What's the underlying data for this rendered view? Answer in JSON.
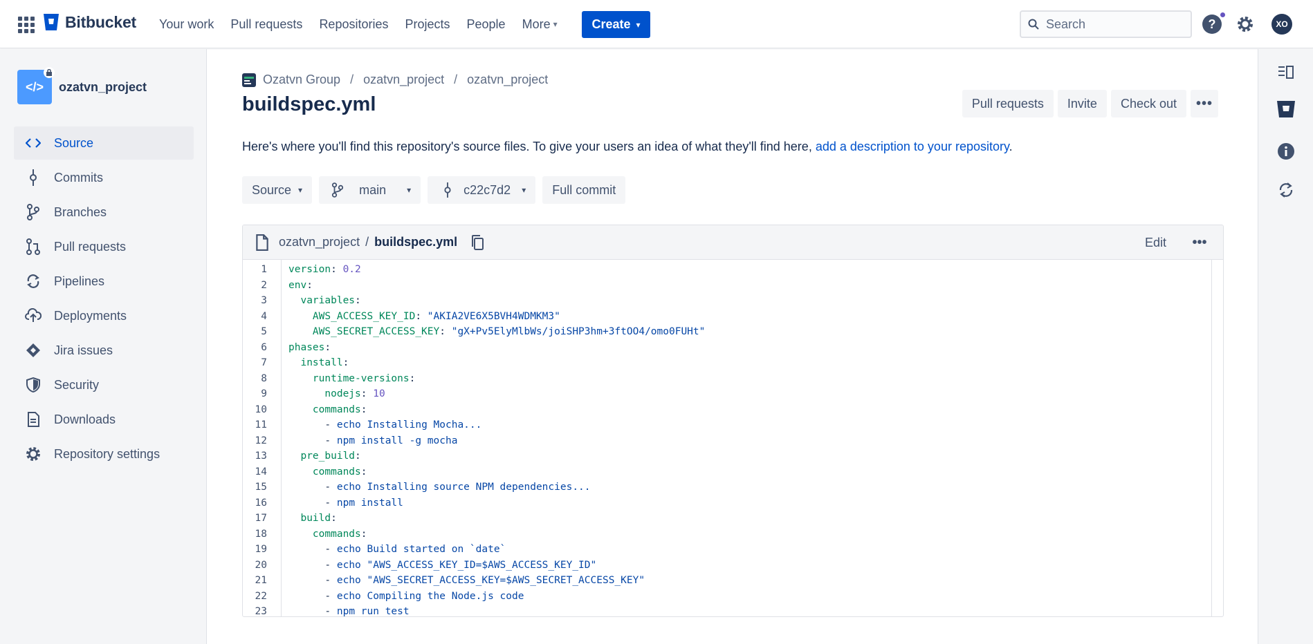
{
  "nav": {
    "product": "Bitbucket",
    "items": [
      "Your work",
      "Pull requests",
      "Repositories",
      "Projects",
      "People",
      "More"
    ],
    "create_label": "Create",
    "search_placeholder": "Search",
    "avatar_initials": "XO",
    "help_label": "?"
  },
  "sidebar": {
    "repo_name": "ozatvn_project",
    "repo_avatar_glyph": "</>",
    "items": [
      {
        "label": "Source",
        "icon": "code-icon",
        "active": true
      },
      {
        "label": "Commits",
        "icon": "commit-icon"
      },
      {
        "label": "Branches",
        "icon": "branch-icon"
      },
      {
        "label": "Pull requests",
        "icon": "pull-request-icon"
      },
      {
        "label": "Pipelines",
        "icon": "pipelines-icon"
      },
      {
        "label": "Deployments",
        "icon": "deployments-icon"
      },
      {
        "label": "Jira issues",
        "icon": "jira-icon"
      },
      {
        "label": "Security",
        "icon": "shield-icon"
      },
      {
        "label": "Downloads",
        "icon": "document-icon"
      },
      {
        "label": "Repository settings",
        "icon": "gear-icon"
      }
    ]
  },
  "breadcrumb": [
    "Ozatvn Group",
    "ozatvn_project",
    "ozatvn_project"
  ],
  "page": {
    "title": "buildspec.yml",
    "actions": [
      "Pull requests",
      "Invite",
      "Check out"
    ],
    "description_text": "Here's where you'll find this repository's source files. To give your users an idea of what they'll find here, ",
    "description_link": "add a description to your repository",
    "description_end": "."
  },
  "filters": {
    "view": "Source",
    "branch": "main",
    "commit": "c22c7d2",
    "full_commit": "Full commit"
  },
  "file": {
    "repo": "ozatvn_project",
    "name": "buildspec.yml",
    "edit_label": "Edit",
    "lines": [
      "version: 0.2",
      "env:",
      "  variables:",
      "    AWS_ACCESS_KEY_ID: \"AKIA2VE6X5BVH4WDMKM3\"",
      "    AWS_SECRET_ACCESS_KEY: \"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\"",
      "phases:",
      "  install:",
      "    runtime-versions:",
      "      nodejs: 10",
      "    commands:",
      "      - echo Installing Mocha...",
      "      - npm install -g mocha",
      "  pre_build:",
      "    commands:",
      "      - echo Installing source NPM dependencies...",
      "      - npm install",
      "  build:",
      "    commands:",
      "      - echo Build started on `date`",
      "      - echo \"AWS_ACCESS_KEY_ID=$AWS_ACCESS_KEY_ID\"",
      "      - echo \"AWS_SECRET_ACCESS_KEY=$AWS_SECRET_ACCESS_KEY\"",
      "      - echo Compiling the Node.js code",
      "      - npm run test"
    ]
  },
  "colors": {
    "accent": "#0052cc",
    "key": "#00875a",
    "number": "#6554c0",
    "string": "#0747a6"
  }
}
